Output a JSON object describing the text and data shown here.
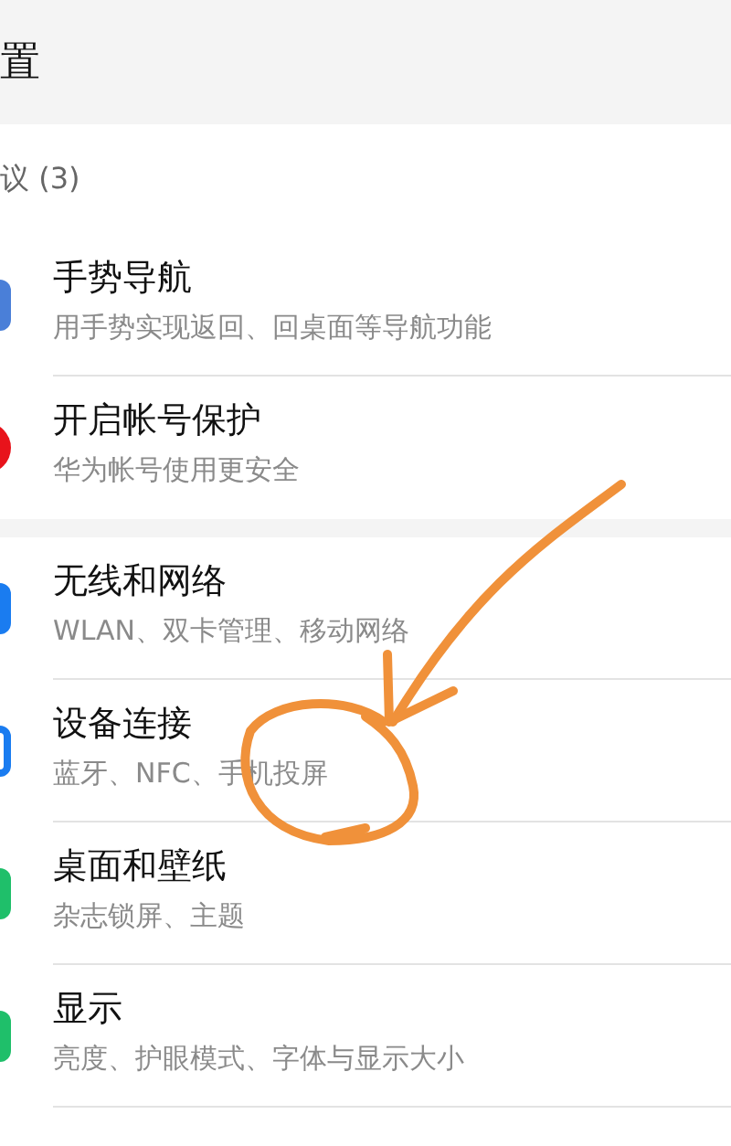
{
  "header": {
    "title": "置"
  },
  "suggestions": {
    "label": "议 (3)",
    "items": [
      {
        "title": "手势导航",
        "subtitle": "用手势实现返回、回桌面等导航功能",
        "color": "#4a7fd8",
        "kind": "rounded"
      },
      {
        "title": "开启帐号保护",
        "subtitle": "华为帐号使用更安全",
        "color": "#e8131b",
        "kind": "circle"
      }
    ]
  },
  "settings": [
    {
      "title": "无线和网络",
      "subtitle": "WLAN、双卡管理、移动网络",
      "color": "#1a7cf0",
      "kind": "rounded"
    },
    {
      "title": "设备连接",
      "subtitle": "蓝牙、NFC、手机投屏",
      "color": "#1a7cf0",
      "kind": "outline"
    },
    {
      "title": "桌面和壁纸",
      "subtitle": "杂志锁屏、主题",
      "color": "#1fbf6a",
      "kind": "rounded"
    },
    {
      "title": "显示",
      "subtitle": "亮度、护眼模式、字体与显示大小",
      "color": "#1fbf6a",
      "kind": "rounded"
    }
  ]
}
